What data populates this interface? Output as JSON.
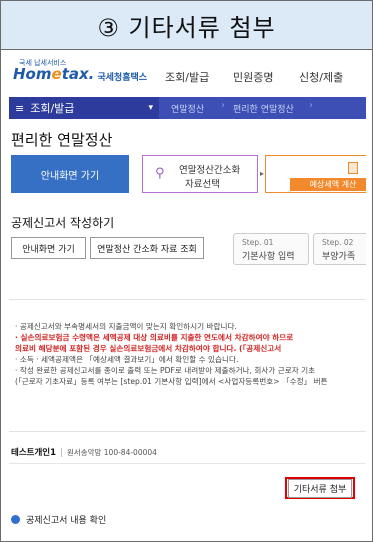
{
  "slide_title": "③ 기타서류 첨부",
  "header": {
    "logo_roof": "국세 납세서비스",
    "logo_home": "Hom",
    "logo_e": "e",
    "logo_tax": "tax.",
    "logo_agency": "국세청홈택스",
    "nav": [
      "조회/발급",
      "민원증명",
      "신청/제출"
    ]
  },
  "breadcrumb": {
    "menu_icon": "≡",
    "current": "조회/발급",
    "chevron": "▾",
    "items": [
      "연말정산",
      "편리한 연말정산"
    ],
    "separator": "›"
  },
  "page_title": "편리한 연말정산",
  "tiles": {
    "guide": "안내화면 가기",
    "simple_select_line1": "연말정산간소화",
    "simple_select_line2": "자료선택",
    "arrow": "▸",
    "tax_calc": "예상세액 계산",
    "search_icon": "search-icon"
  },
  "section_title": "공제신고서 작성하기",
  "buttons": {
    "guide": "안내화면 가기",
    "simple_lookup": "연말정산 간소화 자료 조회"
  },
  "steps": [
    {
      "num": "Step. 01",
      "label": "기본사항 입력"
    },
    {
      "num": "Step. 02",
      "label": "부양가족"
    }
  ],
  "notice": [
    "· 공제신고서와 부속명세서의 지출금액이 맞는지 확인하시기 바랍니다.",
    "· 실손의료보험금 수령액은 세액공제 대상 의료비를 지출한 연도에서 차감하여야 하므로",
    "의료비 해당분에 포함된 경우 실손의료보험금에서 차감하여야 합니다. (「공제신고서",
    "· 소득 · 세액공제액은 「예상세액 결과보기」에서 확인할 수 있습니다.",
    "· 작성 완료한 공제신고서를 종이로 출력 또는 PDF로 내려받아 제출하거나, 회사가 근로자 기초",
    "(「근로자 기초자료」등록 여부는 [step.01 기본사항 입력]에서 <사업자등록번호> 「수정」 버튼"
  ],
  "taxpayer": {
    "name": "테스트개인1",
    "separator": "|",
    "address": "원서송악망 100-84-00004"
  },
  "attach_button": "기타서류 첨부",
  "confirm_section": "공제신고서 내용 확인",
  "colors": {
    "title_bg": "#dce9f7",
    "crumb_bar": "#3d4fb5",
    "tile_blue": "#3570c4",
    "tile_orange": "#f28a2d",
    "highlight": "#e00000",
    "notice_red": "#d22424"
  }
}
